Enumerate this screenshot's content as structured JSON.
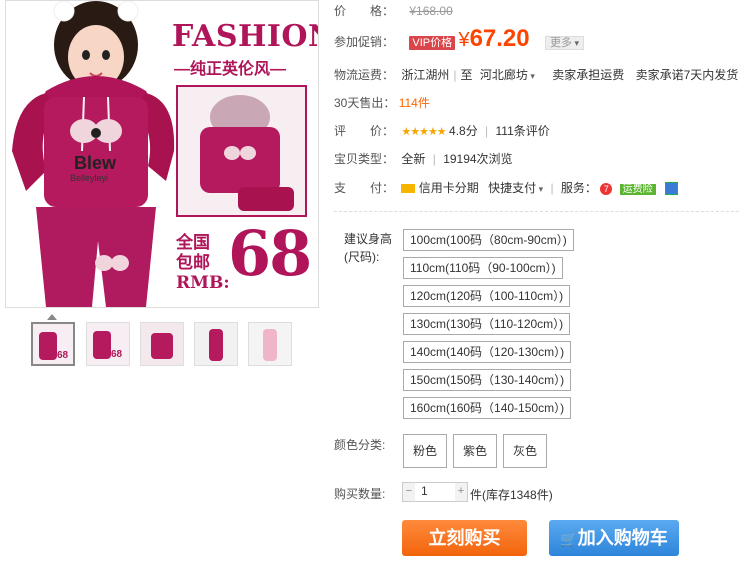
{
  "image": {
    "title": "FASHION",
    "subtitle": "—纯正英伦风—",
    "promo_text": "全国包邮RMB:",
    "promo_line1": "全国",
    "promo_line2": "包邮",
    "promo_line3": "RMB:",
    "promo_price": "68",
    "shirt_text": "Blew",
    "shirt_sub": "Belleyleyi"
  },
  "thumbs": [
    "thumb-1",
    "thumb-2",
    "thumb-3",
    "thumb-4",
    "thumb-5"
  ],
  "price": {
    "label": "价　　格：",
    "original": "¥168.00"
  },
  "promo": {
    "label": "参加促销：",
    "badge": "VIP价格",
    "currency": "¥",
    "value": "67.20",
    "more": "更多"
  },
  "shipping": {
    "label": "物流运费：",
    "from": "浙江湖州",
    "to_label": "至",
    "to": "河北廊坊",
    "fee": "卖家承担运费",
    "promise": "卖家承诺7天内发货"
  },
  "sales": {
    "label": "30天售出：",
    "count": "114",
    "unit": "件"
  },
  "rating": {
    "label": "评　　价：",
    "stars": "★★★★★",
    "score": "4.8分",
    "count": "111条评价"
  },
  "type": {
    "label": "宝贝类型：",
    "value": "全新",
    "views": "19194次浏览"
  },
  "pay": {
    "label": "支　　付：",
    "credit": "信用卡分期",
    "quick": "快捷支付",
    "service_label": "服务：",
    "badge": "运费险"
  },
  "size": {
    "label": "建议身高(尺码):",
    "options": [
      "100cm(100码（80cm-90cm）)",
      "110cm(110码（90-100cm）)",
      "120cm(120码（100-110cm）)",
      "130cm(130码（110-120cm）)",
      "140cm(140码（120-130cm）)",
      "150cm(150码（130-140cm）)",
      "160cm(160码（140-150cm）)"
    ]
  },
  "color": {
    "label": "颜色分类:",
    "options": [
      "粉色",
      "紫色",
      "灰色"
    ]
  },
  "quantity": {
    "label": "购买数量:",
    "value": "1",
    "unit": "件",
    "stock": "(库存1348件)"
  },
  "actions": {
    "buy": "立刻购买",
    "cart": "加入购物车"
  },
  "colors": {
    "brand": "#b0155a",
    "price": "#ff4400",
    "buy": "#f2640c",
    "cart": "#2d84da"
  }
}
